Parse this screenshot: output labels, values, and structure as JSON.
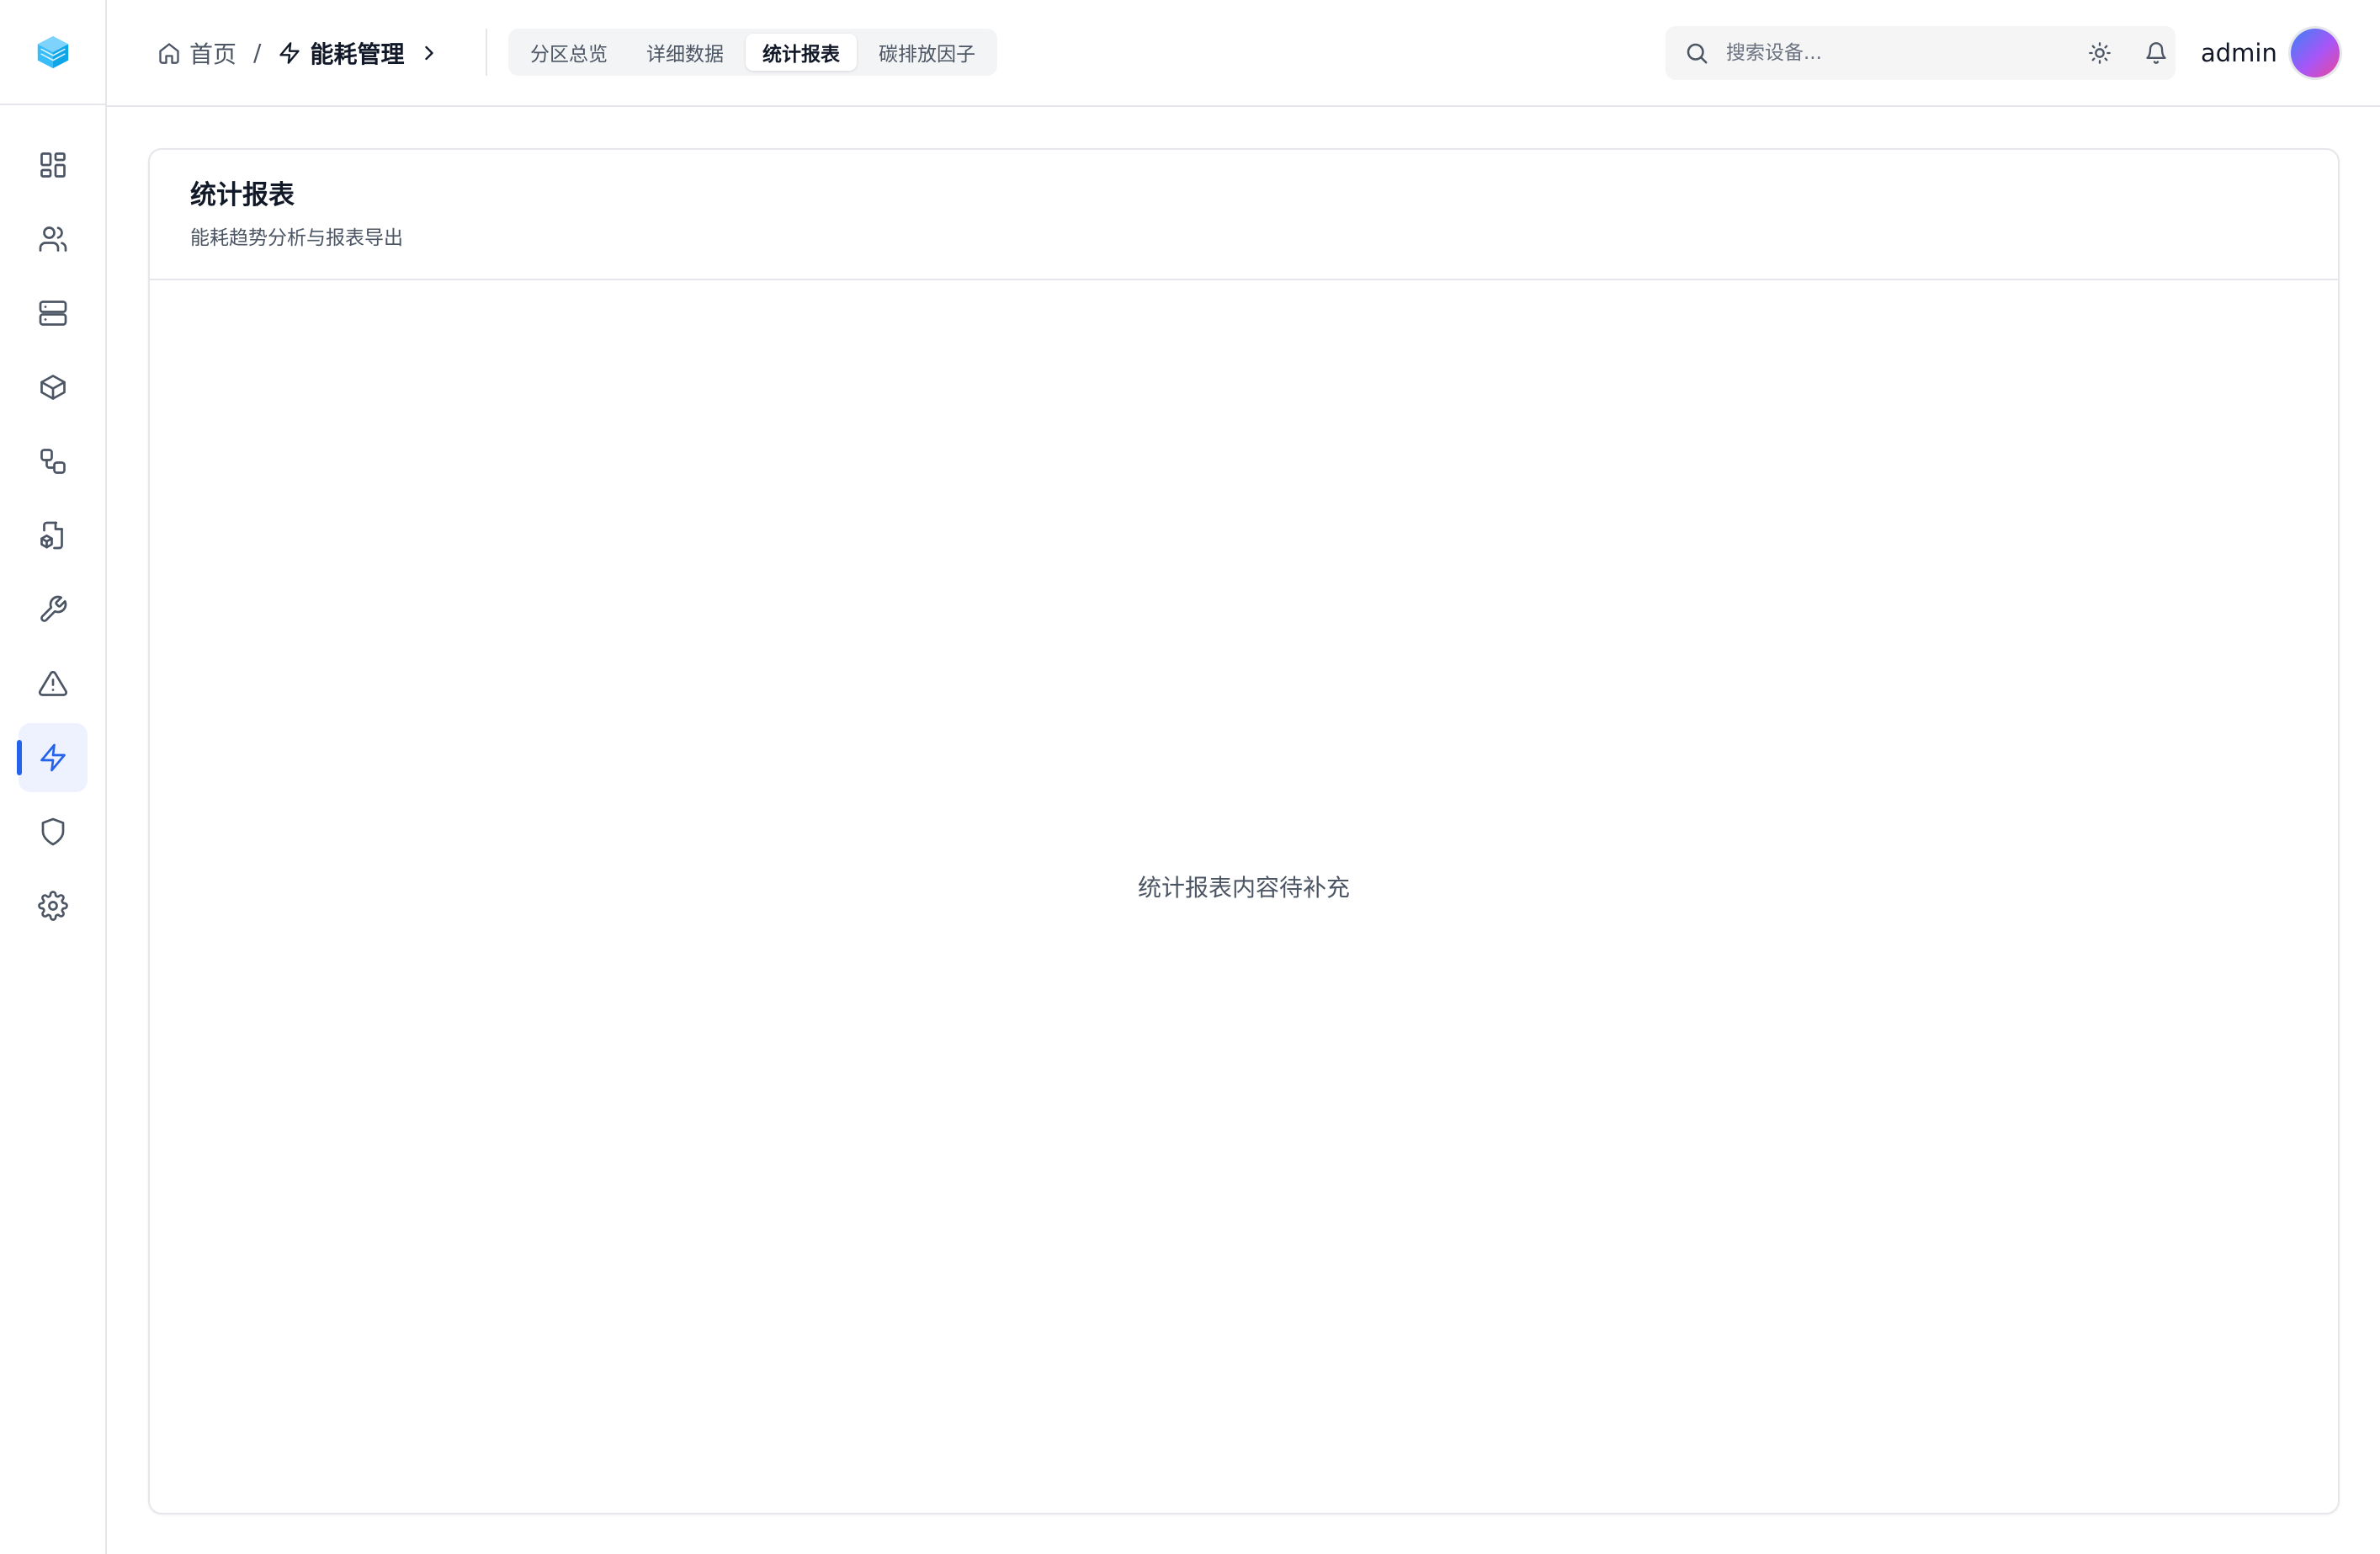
{
  "breadcrumb": {
    "home": "首页",
    "separator": "/",
    "current": "能耗管理"
  },
  "tabs": [
    {
      "label": "分区总览",
      "active": false
    },
    {
      "label": "详细数据",
      "active": false
    },
    {
      "label": "统计报表",
      "active": true
    },
    {
      "label": "碳排放因子",
      "active": false
    }
  ],
  "search": {
    "placeholder": "搜索设备..."
  },
  "user": {
    "name": "admin"
  },
  "sidebar": {
    "items": [
      {
        "icon": "dashboard-icon",
        "active": false
      },
      {
        "icon": "users-icon",
        "active": false
      },
      {
        "icon": "server-icon",
        "active": false
      },
      {
        "icon": "box-icon",
        "active": false
      },
      {
        "icon": "workflow-icon",
        "active": false
      },
      {
        "icon": "file-box-icon",
        "active": false
      },
      {
        "icon": "wrench-icon",
        "active": false
      },
      {
        "icon": "alert-triangle-icon",
        "active": false
      },
      {
        "icon": "zap-icon",
        "active": true
      },
      {
        "icon": "shield-icon",
        "active": false
      },
      {
        "icon": "settings-icon",
        "active": false
      }
    ]
  },
  "card": {
    "title": "统计报表",
    "subtitle": "能耗趋势分析与报表导出",
    "placeholder": "统计报表内容待补充"
  },
  "colors": {
    "accent": "#2563eb",
    "border": "#e5e7eb",
    "text_muted": "#4b5563"
  }
}
